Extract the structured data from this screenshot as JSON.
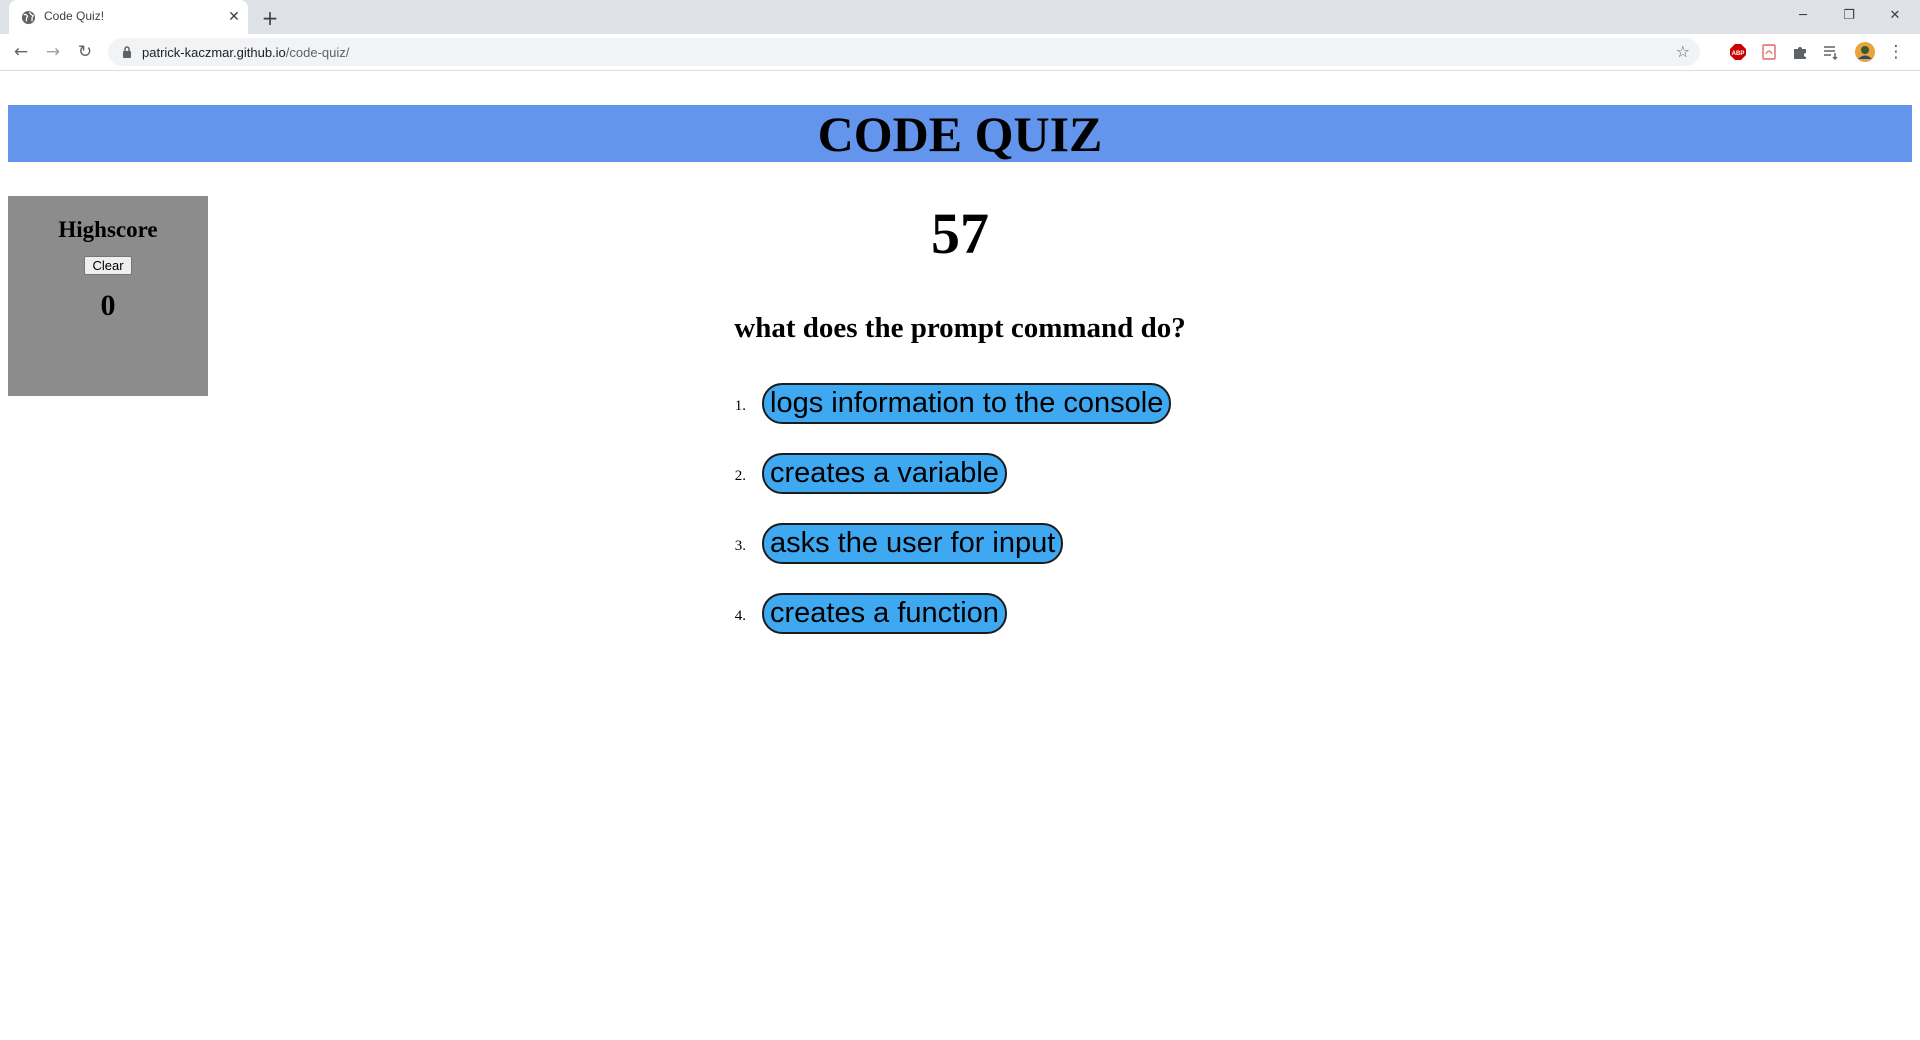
{
  "browser": {
    "tab_title": "Code Quiz!",
    "url_host": "patrick-kaczmar.github.io",
    "url_path": "/code-quiz/"
  },
  "header": {
    "title": "CODE QUIZ"
  },
  "highscore": {
    "title": "Highscore",
    "clear_label": "Clear",
    "value": "0"
  },
  "timer": {
    "value": "57"
  },
  "quiz": {
    "question": "what does the prompt command do?",
    "answers": [
      {
        "number": "1.",
        "label": "logs information to the console"
      },
      {
        "number": "2.",
        "label": "creates a variable"
      },
      {
        "number": "3.",
        "label": "asks the user for input"
      },
      {
        "number": "4.",
        "label": "creates a function"
      }
    ]
  },
  "colors": {
    "header_bg": "#6495ed",
    "highscore_bg": "#8c8c8c",
    "answer_bg": "#3ea8f0"
  }
}
